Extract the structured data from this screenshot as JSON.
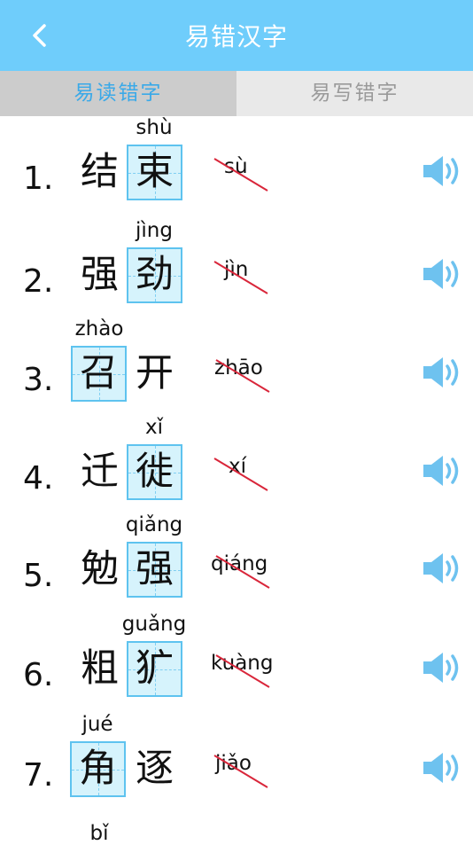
{
  "header": {
    "title": "易错汉字"
  },
  "tabs": [
    {
      "label": "易读错字"
    },
    {
      "label": "易写错字"
    }
  ],
  "items": [
    {
      "number": "1.",
      "pinyin": "shù",
      "char1": "结",
      "char2": "束",
      "wrong": "sù"
    },
    {
      "number": "2.",
      "pinyin": "jìng",
      "char1": "强",
      "char2": "劲",
      "wrong": "jìn"
    },
    {
      "number": "3.",
      "pinyin": "zhào",
      "char1": "召",
      "char2": "开",
      "wrong": "zhāo"
    },
    {
      "number": "4.",
      "pinyin": "xǐ",
      "char1": "迁",
      "char2": "徙",
      "wrong": "xí"
    },
    {
      "number": "5.",
      "pinyin": "qiǎng",
      "char1": "勉",
      "char2": "强",
      "wrong": "qiáng"
    },
    {
      "number": "6.",
      "pinyin": "guǎng",
      "char1": "粗",
      "char2": "犷",
      "wrong": "kuàng"
    },
    {
      "number": "7.",
      "pinyin": "jué",
      "char1": "角",
      "char2": "逐",
      "wrong": "jiǎo"
    }
  ],
  "partial_item": {
    "pinyin": "bǐ"
  },
  "colors": {
    "header_bg": "#6fcdfb",
    "accent": "#3aa9e8",
    "strike": "#d9263a",
    "speaker": "#6ec2ef"
  },
  "icons": {
    "back": "chevron-left-icon",
    "speaker": "speaker-icon"
  }
}
